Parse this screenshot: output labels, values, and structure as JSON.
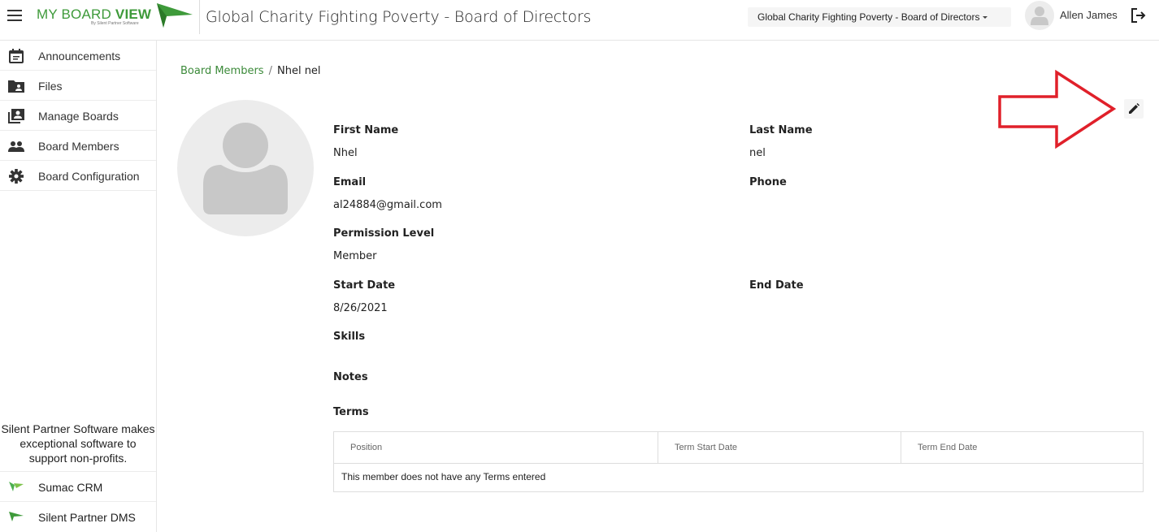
{
  "app": {
    "logo_text_regular": "MY BOARD ",
    "logo_text_bold": "VIEW",
    "logo_subtitle": "By Silent Partner Software",
    "brand_color": "#3e9a3a"
  },
  "header": {
    "title": "Global Charity Fighting Poverty - Board of Directors",
    "board_selector": "Global Charity Fighting Poverty - Board of Directors",
    "user_name": "Allen James"
  },
  "sidebar": {
    "items": [
      {
        "label": "Announcements",
        "icon": "calendar-icon"
      },
      {
        "label": "Files",
        "icon": "folder-shared-icon"
      },
      {
        "label": "Manage Boards",
        "icon": "contacts-stack-icon"
      },
      {
        "label": "Board Members",
        "icon": "people-icon"
      },
      {
        "label": "Board Configuration",
        "icon": "gear-icon"
      }
    ],
    "promo_text": "Silent Partner Software makes exceptional software to support non-profits.",
    "external_links": [
      {
        "label": "Sumac CRM",
        "icon": "sumac-logo-icon"
      },
      {
        "label": "Silent Partner DMS",
        "icon": "silent-partner-logo-icon"
      }
    ]
  },
  "breadcrumb": {
    "parent": "Board Members",
    "separator": "/",
    "current": "Nhel nel"
  },
  "member": {
    "first_name_label": "First Name",
    "first_name": "Nhel",
    "last_name_label": "Last Name",
    "last_name": "nel",
    "email_label": "Email",
    "email": "al24884@gmail.com",
    "phone_label": "Phone",
    "phone": "",
    "permission_label": "Permission Level",
    "permission": "Member",
    "start_date_label": "Start Date",
    "start_date": "8/26/2021",
    "end_date_label": "End Date",
    "end_date": "",
    "skills_label": "Skills",
    "notes_label": "Notes",
    "terms_label": "Terms"
  },
  "terms_table": {
    "columns": [
      "Position",
      "Term Start Date",
      "Term End Date"
    ],
    "empty_message": "This member does not have any Terms entered"
  },
  "annotation": {
    "arrow_color": "#e0202a"
  }
}
